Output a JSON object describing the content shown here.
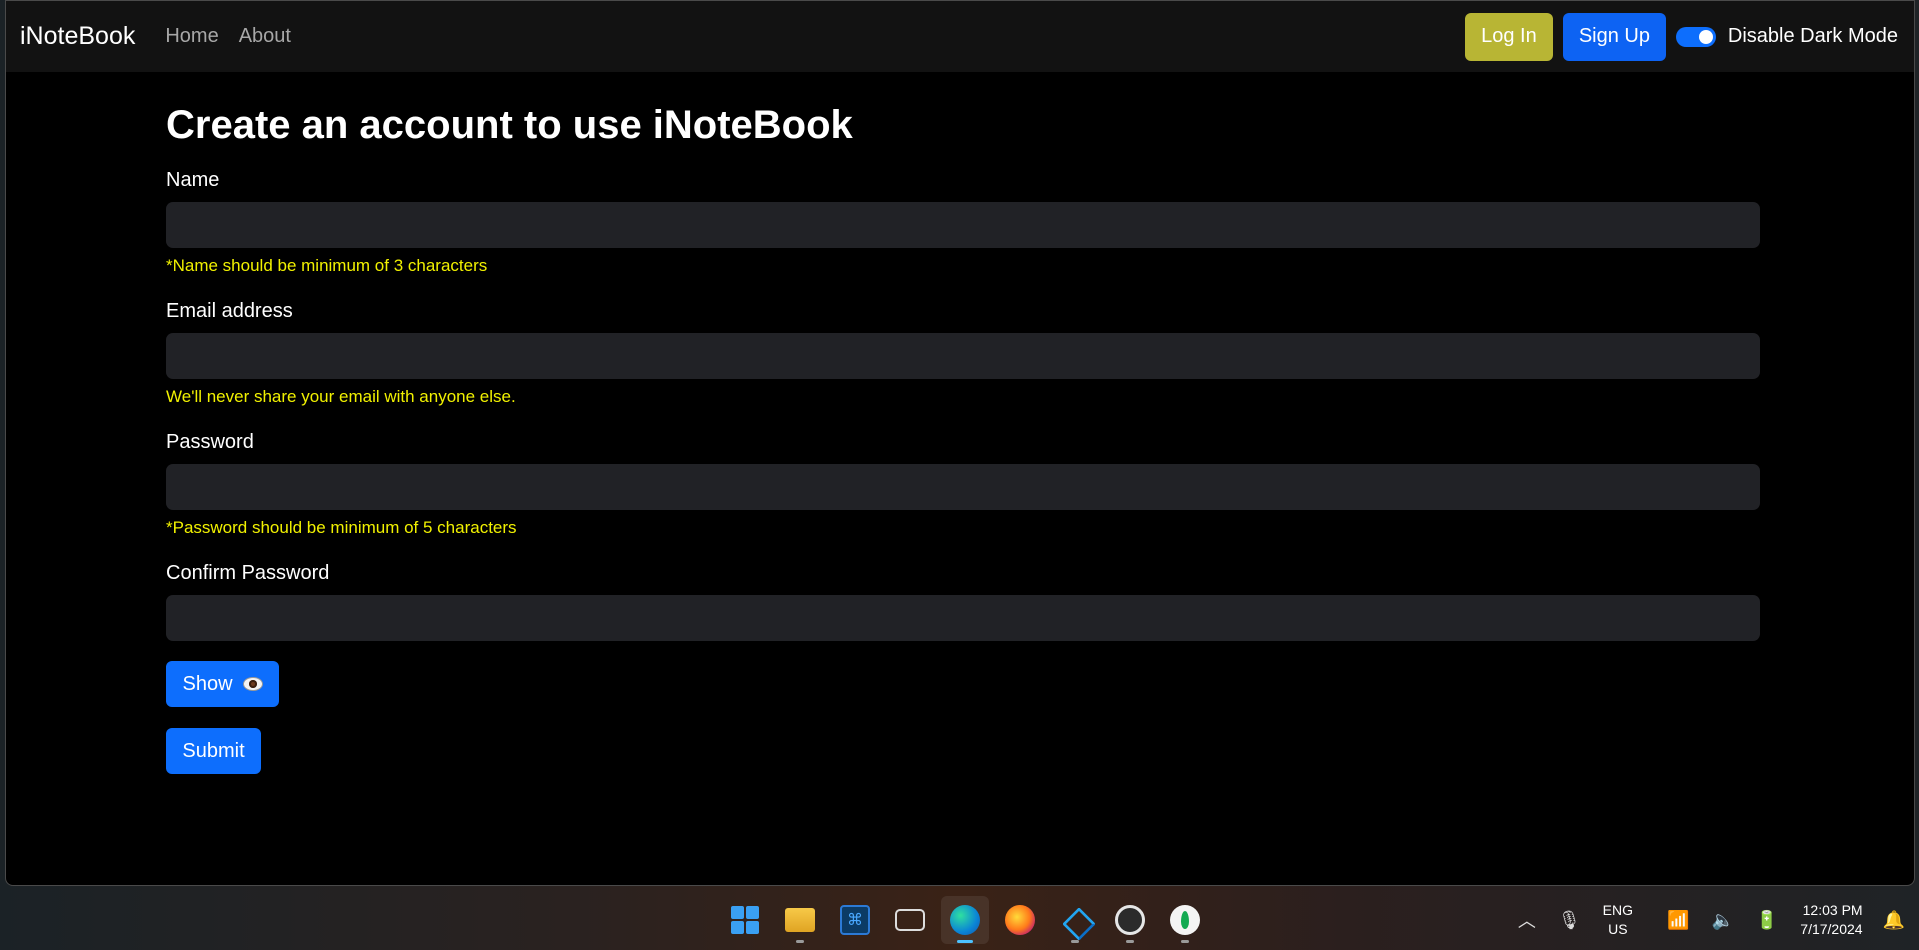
{
  "navbar": {
    "brand": "iNoteBook",
    "links": [
      "Home",
      "About"
    ],
    "login_label": "Log In",
    "signup_label": "Sign Up",
    "dark_mode_label": "Disable Dark Mode",
    "dark_mode_enabled": true
  },
  "form": {
    "title": "Create an account to use iNoteBook",
    "name_label": "Name",
    "name_help": "*Name should be minimum of 3 characters",
    "email_label": "Email address",
    "email_help": "We'll never share your email with anyone else.",
    "password_label": "Password",
    "password_help": "*Password should be minimum of 5 characters",
    "confirm_label": "Confirm Password",
    "show_label": "Show",
    "submit_label": "Submit"
  },
  "colors": {
    "login_button": "#b8b534",
    "primary": "#0d6efd",
    "help_text": "#f1f100",
    "input_bg": "#212226"
  },
  "taskbar": {
    "apps": [
      "start-icon",
      "file-explorer-icon",
      "app-icon",
      "remote-desktop-icon",
      "edge-icon",
      "firefox-icon",
      "vscode-icon",
      "obs-icon",
      "mongodb-compass-icon"
    ],
    "lang_line1": "ENG",
    "lang_line2": "US",
    "time": "12:03 PM",
    "date": "7/17/2024"
  }
}
